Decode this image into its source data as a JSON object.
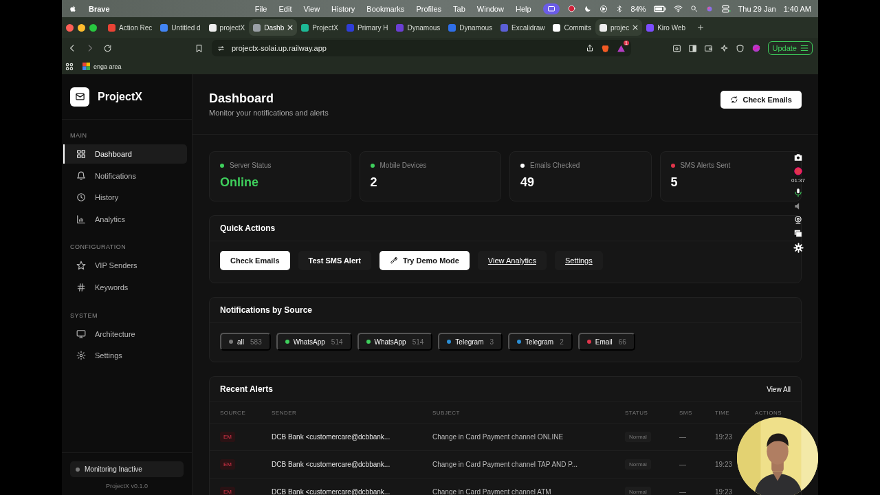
{
  "menu_bar": {
    "app": "Brave",
    "items": [
      "File",
      "Edit",
      "View",
      "History",
      "Bookmarks",
      "Profiles",
      "Tab",
      "Window",
      "Help"
    ],
    "battery": "84%",
    "date": "Thu 29 Jan",
    "time": "1:40 AM"
  },
  "tabs": [
    {
      "title": "Action Rec",
      "selected": false,
      "hovered": false
    },
    {
      "title": "Untitled d",
      "selected": false,
      "hovered": false
    },
    {
      "title": "projectX",
      "selected": false,
      "hovered": false
    },
    {
      "title": "Dashb",
      "selected": true,
      "hovered": false
    },
    {
      "title": "ProjectX",
      "selected": false,
      "hovered": false
    },
    {
      "title": "Primary H",
      "selected": false,
      "hovered": false
    },
    {
      "title": "Dynamous",
      "selected": false,
      "hovered": false
    },
    {
      "title": "Dynamous",
      "selected": false,
      "hovered": false
    },
    {
      "title": "Excalidraw",
      "selected": false,
      "hovered": false
    },
    {
      "title": "Commits",
      "selected": false,
      "hovered": false
    },
    {
      "title": "projec",
      "selected": false,
      "hovered": true
    },
    {
      "title": "Kiro Web",
      "selected": false,
      "hovered": false
    }
  ],
  "address_bar": {
    "url": "projectx-solai.up.railway.app",
    "badge": "1",
    "update_button": "Update"
  },
  "bookmarks": [
    "enga area"
  ],
  "sidebar": {
    "brand": "ProjectX",
    "sections": [
      {
        "heading": "MAIN",
        "items": [
          {
            "label": "Dashboard",
            "selected": true
          },
          {
            "label": "Notifications",
            "selected": false
          },
          {
            "label": "History",
            "selected": false
          },
          {
            "label": "Analytics",
            "selected": false
          }
        ]
      },
      {
        "heading": "CONFIGURATION",
        "items": [
          {
            "label": "VIP Senders",
            "selected": false
          },
          {
            "label": "Keywords",
            "selected": false
          }
        ]
      },
      {
        "heading": "SYSTEM",
        "items": [
          {
            "label": "Architecture",
            "selected": false
          },
          {
            "label": "Settings",
            "selected": false
          }
        ]
      }
    ],
    "monitoring": {
      "label": "Monitoring Inactive",
      "active": false
    },
    "version": "ProjectX v0.1.0"
  },
  "header": {
    "title": "Dashboard",
    "subtitle": "Monitor your notifications and alerts",
    "action": "Check Emails"
  },
  "stats": [
    {
      "label": "Server Status",
      "value": "Online",
      "color": "#3ecf5c",
      "highlight": true
    },
    {
      "label": "Mobile Devices",
      "value": "2",
      "color": "#3ecf5c",
      "highlight": false
    },
    {
      "label": "Emails Checked",
      "value": "49",
      "color": "#ffffff",
      "highlight": false
    },
    {
      "label": "SMS Alerts Sent",
      "value": "5",
      "color": "#e0354b",
      "highlight": false
    }
  ],
  "quick_actions": {
    "title": "Quick Actions",
    "buttons": [
      {
        "label": "Check Emails",
        "kind": "primary"
      },
      {
        "label": "Test SMS Alert",
        "kind": "secondary"
      },
      {
        "label": "Try Demo Mode",
        "kind": "primary-icon"
      },
      {
        "label": "View Analytics",
        "kind": "link"
      },
      {
        "label": "Settings",
        "kind": "link"
      }
    ]
  },
  "sources": {
    "title": "Notifications by Source",
    "chips": [
      {
        "label": "all",
        "count": "583",
        "color": "#7a7a7a"
      },
      {
        "label": "WhatsApp",
        "count": "514",
        "color": "#3ecf5c"
      },
      {
        "label": "WhatsApp",
        "count": "514",
        "color": "#3ecf5c"
      },
      {
        "label": "Telegram",
        "count": "3",
        "color": "#2b8fd6"
      },
      {
        "label": "Telegram",
        "count": "2",
        "color": "#2b8fd6"
      },
      {
        "label": "Email",
        "count": "66",
        "color": "#e0354b"
      }
    ]
  },
  "recent_alerts": {
    "title": "Recent Alerts",
    "view_all": "View All",
    "columns": [
      "SOURCE",
      "SENDER",
      "SUBJECT",
      "STATUS",
      "SMS",
      "TIME",
      "ACTIONS"
    ],
    "rows": [
      {
        "source": "EM",
        "sender": "DCB Bank <customercare@dcbbank...",
        "subject": "Change in Card Payment channel ONLINE",
        "status": "Normal",
        "sms": "—",
        "time": "19:23"
      },
      {
        "source": "EM",
        "sender": "DCB Bank <customercare@dcbbank...",
        "subject": "Change in Card Payment channel TAP AND P...",
        "status": "Normal",
        "sms": "—",
        "time": "19:23"
      },
      {
        "source": "EM",
        "sender": "DCB Bank <customercare@dcbbank...",
        "subject": "Change in Card Payment channel ATM",
        "status": "Normal",
        "sms": "—",
        "time": "19:23"
      }
    ]
  },
  "recorder": {
    "elapsed": "01:37"
  }
}
